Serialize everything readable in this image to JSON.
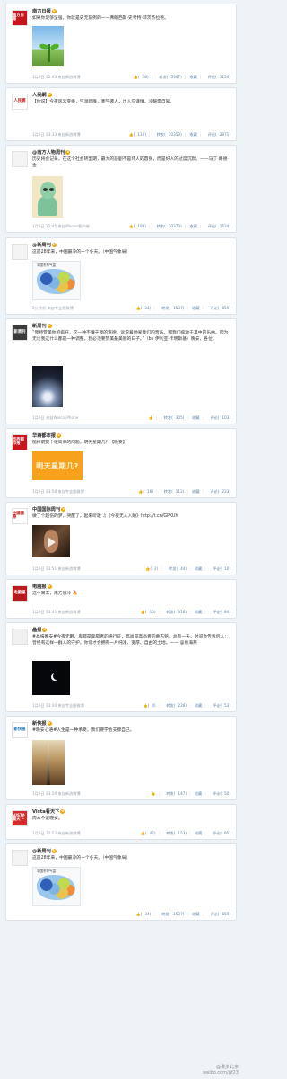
{
  "feed": [
    {
      "id": "p1",
      "user": "南方日报",
      "verified": true,
      "avatar_text": "南方日報",
      "avatar_color": "#c5161d",
      "text": "如果你足够坚强，你就是史无前例的——弗朗西斯·史考特·菲茨杰拉德。",
      "media": "sprout-image",
      "time": "1月6日 22:43",
      "source": "来自新浪微博",
      "likes": "78",
      "reposts": "5367",
      "favorite": "收藏",
      "comments": "1154"
    },
    {
      "id": "p2",
      "user": "人民網",
      "verified": true,
      "avatar_text": "人民網",
      "avatar_color": "#ffffff",
      "text": "【你说】今夜风云变换，气温骤降，寒气袭人。出入应谨慎，冷暖需自知。",
      "time": "1月6日 23:33",
      "source": "来自新浪微博",
      "likes": "110",
      "reposts": "10359",
      "favorite": "收藏",
      "comments": "2971"
    },
    {
      "id": "p3",
      "user": "@南方人物周刊",
      "verified": true,
      "avatar_text": "",
      "avatar_color": "#ffffff",
      "text": "历史将会记录，在这个社会转型期，最大的悲剧不是坏人的嚣张，而是好人的过度沉默。——马丁·路德·金",
      "media": "cartoon-image",
      "time": "1月6日 22:45",
      "source": "来自iPhone客户端",
      "likes": "186",
      "reposts": "10373",
      "favorite": "收藏",
      "comments": "1634"
    },
    {
      "id": "p4",
      "user": "@新周刊",
      "verified": true,
      "avatar_text": "",
      "avatar_color": "#ffffff",
      "text": "这是28年来，中国最冷的一个冬天。（中国气象局）",
      "media": "map-image",
      "time": "5分钟前",
      "source": "来自专业版微博",
      "likes": "34",
      "reposts": "1537",
      "favorite": "收藏",
      "comments": "659"
    },
    {
      "id": "p5",
      "user": "新周刊",
      "verified": true,
      "avatar_text": "新周刊",
      "avatar_color": "#3b3b3b",
      "text": "“我特赞美你的疯狂，这一种不懂于我的道德。诉说着她爱我们的音乐。那我们疯动于其中的乐曲。因为无论我这什么都是一种调整，我必须要赞美最美丽的日子。”（by 伊利亚·卡明斯基）晚安，各位。",
      "media": "night-image",
      "time": "1月6日",
      "source": "来自Weico.iPhone",
      "likes": "",
      "reposts": "305",
      "favorite": "收藏",
      "comments": "103"
    },
    {
      "id": "p6",
      "user": "华西都市报",
      "verified": true,
      "avatar_text": "华西都市报",
      "avatar_color": "#c9161d",
      "text": "槌棒前提个很简单的问题，明天星期几？【晚安】",
      "media_text": "明天星期几?",
      "time": "1月6日 23:58",
      "source": "来自专业版微博",
      "likes": "16",
      "reposts": "112",
      "favorite": "收藏",
      "comments": "233"
    },
    {
      "id": "p7",
      "user": "中国国际周刊",
      "verified": true,
      "avatar_text": "中國國際",
      "avatar_color": "#ffffff",
      "text": "做了个超伤的梦，哭醒了，起来听歌 ♫《今夜无人入睡》http://t.cn/GPKUh",
      "media": "video-image",
      "time": "1月6日 23:51",
      "source": "来自新浪微博",
      "likes": "2",
      "reposts": "44",
      "favorite": "收藏",
      "comments": "10"
    },
    {
      "id": "p8",
      "user": "电脑报",
      "verified": true,
      "avatar_text": "电脑报",
      "avatar_color": "#b71c1c",
      "text": "这个周末，南方很冷 🔥",
      "time": "1月6日 23:41",
      "source": "来自新浪微博",
      "likes": "15",
      "reposts": "316",
      "favorite": "收藏",
      "comments": "84"
    },
    {
      "id": "p9",
      "user": "晶报",
      "verified": true,
      "avatar_text": "",
      "avatar_color": "#ffffff",
      "text": "#晶报晚安#今夜无眠，卑鄙是卑鄙者的通行证，高尚是高尚者的墓志铭。总有一天，时间会告诉后人：曾经有这样一群人的守护，你们才会拥有一片纯净、宽厚、自由的土地。—— @易海燕",
      "media": "moon-image",
      "time": "1月6日 23:30",
      "source": "来自专业版微博",
      "likes": "4",
      "reposts": "228",
      "favorite": "收藏",
      "comments": "53"
    },
    {
      "id": "p10",
      "user": "新快报",
      "verified": true,
      "avatar_text": "新快报",
      "avatar_color": "#ffffff",
      "text": "#晚安心语#人生是一种承受，我们要学会支撑自己。",
      "media": "road-image",
      "time": "1月6日 23:29",
      "source": "来自新浪微博",
      "likes": "",
      "reposts": "147",
      "favorite": "收藏",
      "comments": "50"
    },
    {
      "id": "p11",
      "user": "Vista看天下",
      "verified": true,
      "avatar_text": "VISTA 看天下",
      "avatar_color": "#d42c2c",
      "text": "周末不说晚安。",
      "time": "1月6日 22:53",
      "source": "来自新浪微博",
      "likes": "42",
      "reposts": "153",
      "favorite": "收藏",
      "comments": "95"
    },
    {
      "id": "p12",
      "user": "@新周刊",
      "verified": true,
      "avatar_text": "",
      "avatar_color": "#ffffff",
      "text": "这是28年来，中国最冷的一个冬天。（中国气象局）",
      "media": "map-image",
      "time": "",
      "source": "",
      "likes": "34",
      "reposts": "1537",
      "favorite": "收藏",
      "comments": "659"
    }
  ],
  "labels": {
    "repost": "转发",
    "comment": "评论",
    "favorite": "收藏",
    "map_title": "中国冬季气温"
  },
  "watermark": {
    "line1": "@漫步北京",
    "line2": "weibo.com/gf23"
  }
}
